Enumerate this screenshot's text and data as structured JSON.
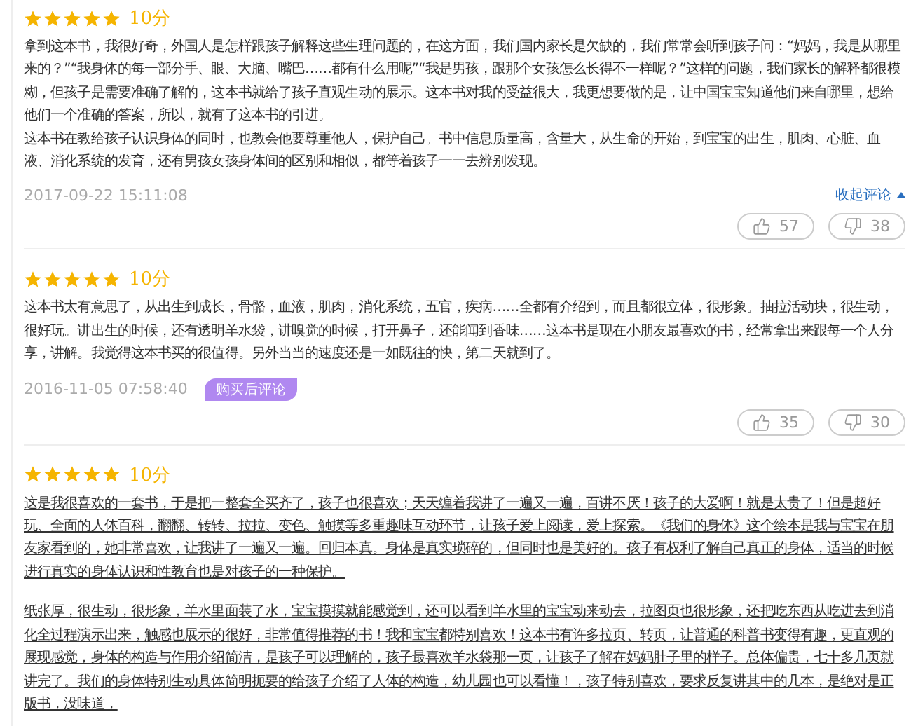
{
  "reviews": [
    {
      "stars": 5,
      "score": "10分",
      "underlined": false,
      "paragraphs": [
        "拿到这本书，我很好奇，外国人是怎样跟孩子解释这些生理问题的，在这方面，我们国内家长是欠缺的，我们常常会听到孩子问：“妈妈，我是从哪里来的？”“我身体的每一部分手、眼、大脑、嘴巴……都有什么用呢”“我是男孩，跟那个女孩怎么长得不一样呢？”这样的问题，我们家长的解释都很模糊，但孩子是需要准确了解的，这本书就给了孩子直观生动的展示。这本书对我的受益很大，我更想要做的是，让中国宝宝知道他们来自哪里，想给他们一个准确的答案，所以，就有了这本书的引进。",
        "这本书在教给孩子认识身体的同时，也教会他要尊重他人，保护自己。书中信息质量高，含量大，从生命的开始，到宝宝的出生，肌肉、心脏、血液、消化系统的发育，还有男孩女孩身体间的区别和相似，都等着孩子一一去辨别发现。"
      ],
      "date": "2017-09-22 15:11:08",
      "collapse_link": "收起评论",
      "likes": "57",
      "dislikes": "38"
    },
    {
      "stars": 5,
      "score": "10分",
      "underlined": false,
      "paragraphs": [
        "这本书太有意思了，从出生到成长，骨骼，血液，肌肉，消化系统，五官，疾病……全都有介绍到，而且都很立体，很形象。抽拉活动块，很生动，很好玩。讲出生的时候，还有透明羊水袋，讲嗅觉的时候，打开鼻子，还能闻到香味……这本书是现在小朋友最喜欢的书，经常拿出来跟每一个人分享，讲解。我觉得这本书买的很值得。另外当当的速度还是一如既往的快，第二天就到了。"
      ],
      "date": "2016-11-05 07:58:40",
      "tag": "购买后评论",
      "likes": "35",
      "dislikes": "30"
    },
    {
      "stars": 5,
      "score": "10分",
      "underlined": true,
      "paragraphs": [
        "这是我很喜欢的一套书，于是把一整套全买齐了，孩子也很喜欢；天天缠着我讲了一遍又一遍，百讲不厌！孩子的大爱啊！就是太贵了！但是超好玩、全面的人体百科，翻翻、转转、拉拉、变色、触摸等多重趣味互动环节，让孩子爱上阅读，爱上探索。《我们的身体》这个绘本是我与宝宝在朋友家看到的，她非常喜欢，让我讲了一遍又一遍。回归本真。身体是真实琐碎的，但同时也是美好的。孩子有权利了解自己真正的身体，适当的时候进行真实的身体认识和性教育也是对孩子的一种保护。",
        "纸张厚，很生动，很形象，羊水里面装了水，宝宝摸摸就能感觉到，还可以看到羊水里的宝宝动来动去，拉图页也很形象，还把吃东西从吃进去到消化全过程演示出来，触感也展示的很好，非常值得推荐的书！我和宝宝都特别喜欢！这本书有许多拉页、转页，让普通的科普书变得有趣，更直观的展现感觉，身体的构造与作用介绍简洁，是孩子可以理解的，孩子最喜欢羊水袋那一页，让孩子了解在妈妈肚子里的样子。总体偏贵，七十多几页就讲完了。我们的身体特别生动具体简明扼要的给孩子介绍了人体的构造，幼儿园也可以看懂！，孩子特别喜欢，要求反复讲其中的几本，是绝对是正版书，没味道，"
      ]
    }
  ]
}
